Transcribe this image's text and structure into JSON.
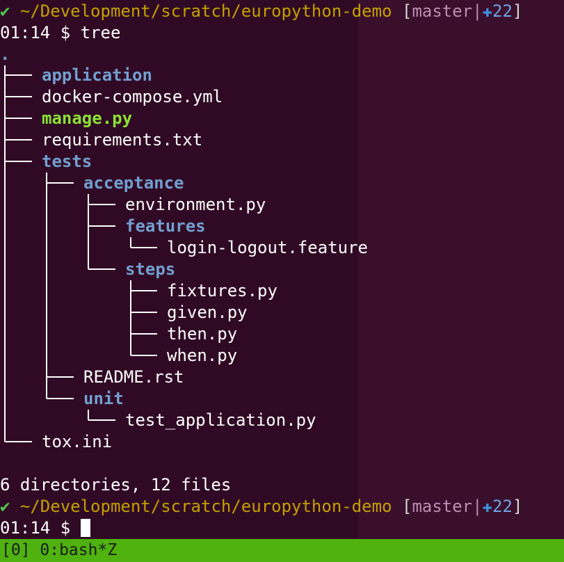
{
  "prompt": {
    "check_icon": "✔",
    "path": "~/Development/scratch/europython-demo",
    "branch_open": "[",
    "branch": "master",
    "branch_sep": "|",
    "plus_icon": "✚",
    "changes": "22",
    "branch_close": "]",
    "time": "01:14",
    "symbol": "$"
  },
  "command": "tree",
  "tree": {
    "root": ".",
    "entries": [
      {
        "name": "application",
        "kind": "dir"
      },
      {
        "name": "docker-compose.yml",
        "kind": "file"
      },
      {
        "name": "manage.py",
        "kind": "exe"
      },
      {
        "name": "requirements.txt",
        "kind": "file"
      },
      {
        "name": "tests",
        "kind": "dir"
      },
      {
        "name": "acceptance",
        "kind": "dir"
      },
      {
        "name": "environment.py",
        "kind": "file"
      },
      {
        "name": "features",
        "kind": "dir"
      },
      {
        "name": "login-logout.feature",
        "kind": "file"
      },
      {
        "name": "steps",
        "kind": "dir"
      },
      {
        "name": "fixtures.py",
        "kind": "file"
      },
      {
        "name": "given.py",
        "kind": "file"
      },
      {
        "name": "then.py",
        "kind": "file"
      },
      {
        "name": "when.py",
        "kind": "file"
      },
      {
        "name": "README.rst",
        "kind": "file"
      },
      {
        "name": "unit",
        "kind": "dir"
      },
      {
        "name": "test_application.py",
        "kind": "file"
      },
      {
        "name": "tox.ini",
        "kind": "file"
      }
    ]
  },
  "summary": "6 directories, 12 files",
  "status_bar": "[0] 0:bash*Z",
  "colors": {
    "background": "#300a24",
    "directory": "#729fcf",
    "executable": "#8ae234",
    "path": "#c4a000",
    "status_bar": "#4fb20f"
  }
}
